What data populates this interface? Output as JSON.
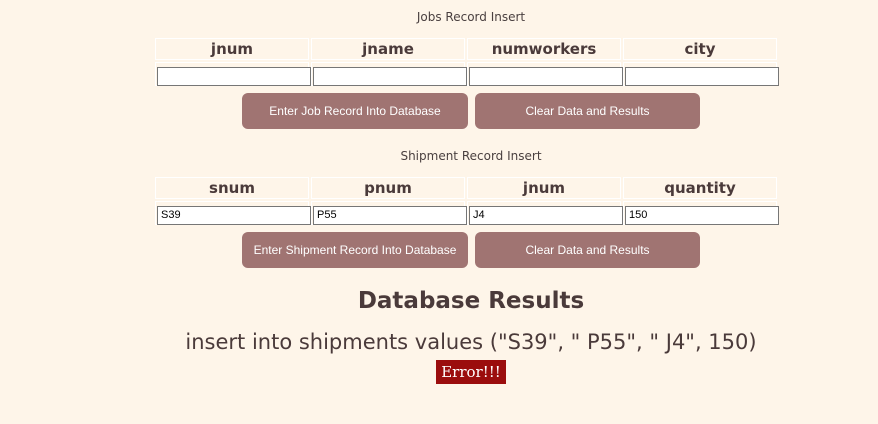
{
  "jobs": {
    "title": "Jobs Record Insert",
    "headers": [
      "jnum",
      "jname",
      "numworkers",
      "city"
    ],
    "values": [
      "",
      "",
      "",
      ""
    ],
    "submit_label": "Enter Job Record Into Database",
    "clear_label": "Clear Data and Results"
  },
  "shipments": {
    "title": "Shipment Record Insert",
    "headers": [
      "snum",
      "pnum",
      "jnum",
      "quantity"
    ],
    "values": [
      "S39",
      "P55",
      "J4",
      "150"
    ],
    "submit_label": "Enter Shipment Record Into Database",
    "clear_label": "Clear Data and Results"
  },
  "results": {
    "title": "Database Results",
    "query": "insert into shipments values (\"S39\", \" P55\", \" J4\", 150)",
    "error": "Error!!!"
  },
  "colors": {
    "background": "#fef5e9",
    "button": "#a07472",
    "error": "#9b0d0d"
  }
}
